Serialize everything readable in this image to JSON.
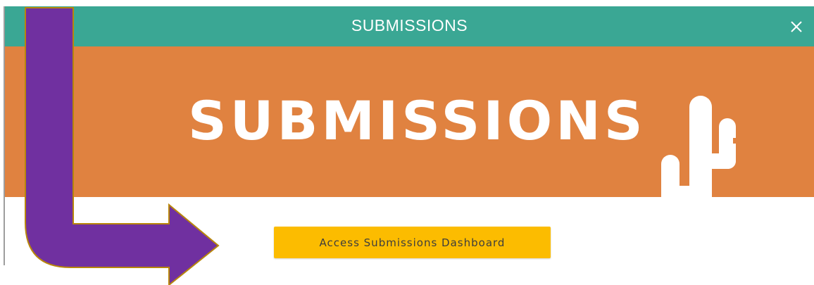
{
  "modal": {
    "title": "SUBMISSIONS",
    "close_icon": "close-icon",
    "colors": {
      "titlebar": "#3aa794",
      "banner": "#e08240",
      "button": "#fcbc00",
      "annotation_arrow": "#7030a0"
    }
  },
  "banner": {
    "heading": "SUBMISSIONS",
    "illustration_icon": "cactus-icon"
  },
  "actions": {
    "dashboard_button_label": "Access Submissions Dashboard"
  },
  "annotation": {
    "icon": "elbow-arrow-icon"
  }
}
